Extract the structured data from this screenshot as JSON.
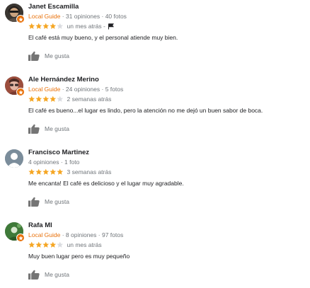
{
  "colors": {
    "star_filled": "#f5a623",
    "star_empty": "#dadce0",
    "local_guide": "#e8710a",
    "secondary_text": "#70757a",
    "primary_text": "#202124"
  },
  "reviews": [
    {
      "name": "Janet Escamilla",
      "local_guide_label": "Local Guide",
      "stats": " · 31 opiniones · 40 fotos",
      "rating": 4,
      "time": "un mes atrás -",
      "has_flag": true,
      "text": "El café está muy bueno, y el personal atiende muy bien.",
      "like_label": "Me gusta",
      "avatar_icon": "user-photo-icon"
    },
    {
      "name": "Ale Hernández Merino",
      "local_guide_label": "Local Guide",
      "stats": " · 24 opiniones · 5 fotos",
      "rating": 4,
      "time": "2 semanas atrás",
      "has_flag": false,
      "text": "El café es bueno...el lugar es lindo, pero la atención no me dejó un buen sabor de boca.",
      "like_label": "Me gusta",
      "avatar_icon": "user-photo-icon"
    },
    {
      "name": "Francisco Martinez",
      "local_guide_label": "",
      "stats": "4 opiniones · 1 foto",
      "rating": 5,
      "time": "3 semanas atrás",
      "has_flag": false,
      "text": "Me encanta! El café es delicioso y el lugar muy agradable.",
      "like_label": "Me gusta",
      "avatar_icon": "default-user-icon"
    },
    {
      "name": "Rafa Ml",
      "local_guide_label": "Local Guide",
      "stats": " · 8 opiniones · 97 fotos",
      "rating": 4,
      "time": "un mes atrás",
      "has_flag": false,
      "text": "Muy buen lugar pero es muy pequeño",
      "like_label": "Me gusta",
      "avatar_icon": "user-photo-icon"
    }
  ]
}
